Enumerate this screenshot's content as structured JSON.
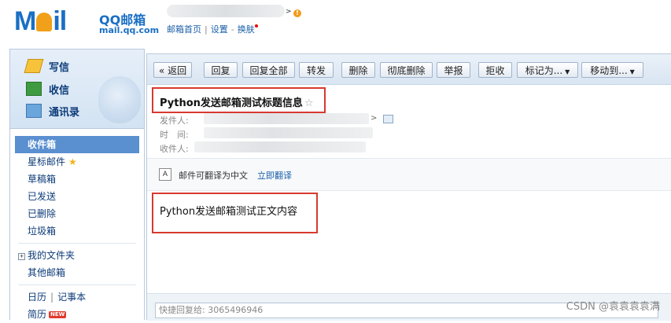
{
  "header": {
    "logo_text": "Moil",
    "brand_name": "QQ邮箱",
    "brand_url": "mail.qq.com",
    "links": [
      "邮箱首页",
      "设置",
      "换肤"
    ]
  },
  "sidebar": {
    "actions": [
      {
        "label": "写信",
        "icon": "pencil-paper-icon"
      },
      {
        "label": "收信",
        "icon": "inbox-arrow-icon"
      },
      {
        "label": "通讯录",
        "icon": "contacts-card-icon"
      }
    ],
    "folders": [
      "收件箱",
      "星标邮件",
      "草稿箱",
      "已发送",
      "已删除",
      "垃圾箱"
    ],
    "selected_folder": "收件箱",
    "my_folders": "我的文件夹",
    "other_mail": "其他邮箱",
    "calendar": "日历",
    "notes": "记事本",
    "resume": "简历",
    "new_badge": "NEW"
  },
  "toolbar": {
    "back": "« 返回",
    "reply": "回复",
    "reply_all": "回复全部",
    "forward": "转发",
    "delete": "删除",
    "delete_permanent": "彻底删除",
    "report": "举报",
    "reject": "拒收",
    "mark_as": "标记为...",
    "move_to": "移动到..."
  },
  "message": {
    "subject": "Python发送邮箱测试标题信息",
    "from_label": "发件人:",
    "time_label": "时　间:",
    "to_label": "收件人:",
    "translate_text": "邮件可翻译为中文",
    "translate_link": "立即翻译",
    "body": "Python发送邮箱测试正文内容"
  },
  "reply": {
    "placeholder": "快捷回复给: 3065496946"
  },
  "watermark": "CSDN @袁袁袁袁满",
  "colors": {
    "highlight_box": "#d73a2f",
    "selected_folder_bg": "#5a8fd0",
    "link": "#1a5fa8"
  }
}
